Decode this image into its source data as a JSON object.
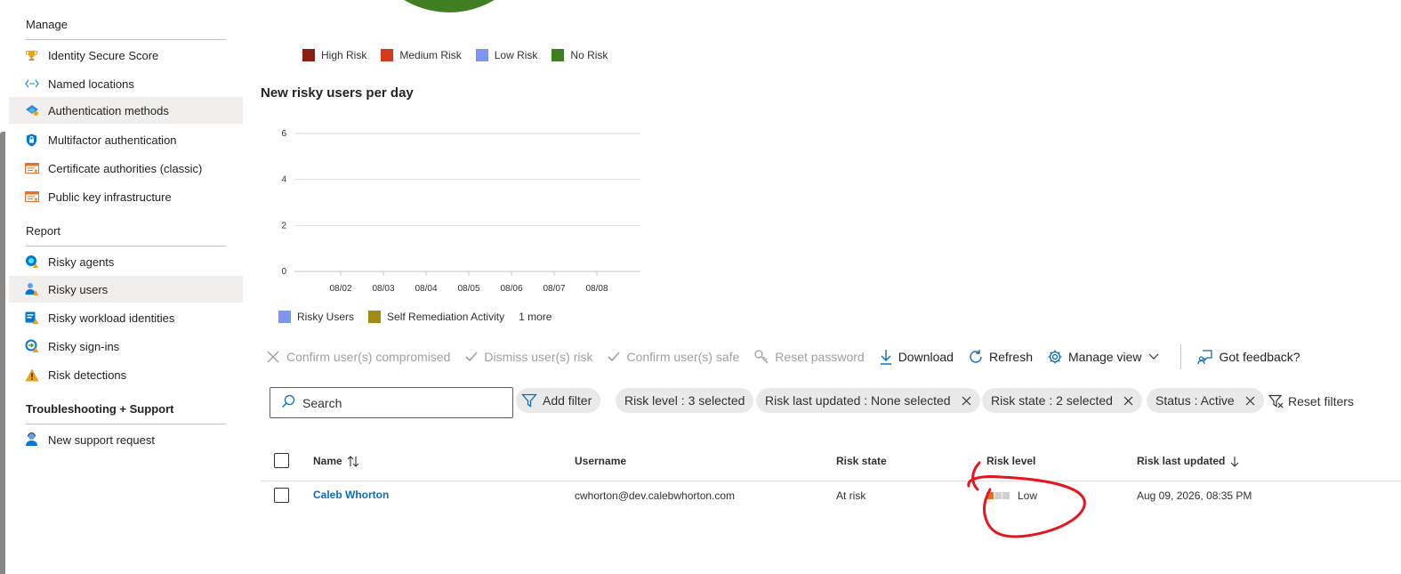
{
  "sidebar": {
    "sections": [
      {
        "title": "Manage"
      },
      {
        "title": "Report"
      },
      {
        "title": "Troubleshooting + Support"
      }
    ],
    "manage_items": [
      {
        "label": "Identity Secure Score",
        "icon": "trophy-icon"
      },
      {
        "label": "Named locations",
        "icon": "named-locations-icon"
      },
      {
        "label": "Authentication methods",
        "icon": "authentication-methods-icon"
      },
      {
        "label": "Multifactor authentication",
        "icon": "lock-shield-icon"
      },
      {
        "label": "Certificate authorities (classic)",
        "icon": "certificate-icon"
      },
      {
        "label": "Public key infrastructure",
        "icon": "certificate-icon"
      }
    ],
    "report_items": [
      {
        "label": "Risky agents",
        "icon": "risky-agents-icon"
      },
      {
        "label": "Risky users",
        "icon": "risky-users-icon"
      },
      {
        "label": "Risky workload identities",
        "icon": "workload-identities-icon"
      },
      {
        "label": "Risky sign-ins",
        "icon": "risky-signins-icon"
      },
      {
        "label": "Risk detections",
        "icon": "warning-icon"
      }
    ],
    "support_items": [
      {
        "label": "New support request",
        "icon": "support-person-icon"
      }
    ],
    "selected": [
      "Authentication methods",
      "Risky users"
    ]
  },
  "risk_legend": [
    {
      "label": "High Risk",
      "color": "#8b1f12"
    },
    {
      "label": "Medium Risk",
      "color": "#d13a1b"
    },
    {
      "label": "Low Risk",
      "color": "#7f95f0"
    },
    {
      "label": "No Risk",
      "color": "#3f7f22"
    }
  ],
  "chart_title": "New risky users per day",
  "chart_data": {
    "type": "bar",
    "title": "New risky users per day",
    "categories": [
      "08/02",
      "08/03",
      "08/04",
      "08/05",
      "08/06",
      "08/07",
      "08/08"
    ],
    "series": [
      {
        "name": "Risky Users",
        "values": [
          0,
          0,
          0,
          0,
          0,
          0,
          0
        ],
        "color": "#7f95f0"
      },
      {
        "name": "Self Remediation Activity",
        "values": [
          0,
          0,
          0,
          0,
          0,
          0,
          0
        ],
        "color": "#a38a14"
      }
    ],
    "yticks": [
      0,
      2,
      4,
      6
    ],
    "ylim": [
      0,
      6
    ],
    "grid": true,
    "legend_extra": "1 more"
  },
  "toolbar": {
    "confirm_compromised": "Confirm user(s) compromised",
    "dismiss_risk": "Dismiss user(s) risk",
    "confirm_safe": "Confirm user(s) safe",
    "reset_password": "Reset password",
    "download": "Download",
    "refresh": "Refresh",
    "manage_view": "Manage view",
    "feedback": "Got feedback?"
  },
  "filters": {
    "search_placeholder": "Search",
    "add_filter": "Add filter",
    "risk_level": "Risk level : 3 selected",
    "risk_last_updated": "Risk last updated : None selected",
    "risk_state": "Risk state : 2 selected",
    "status": "Status : Active",
    "reset": "Reset filters"
  },
  "table": {
    "headers": {
      "name": "Name",
      "username": "Username",
      "risk_state": "Risk state",
      "risk_level": "Risk level",
      "risk_last_updated": "Risk last updated"
    },
    "rows": [
      {
        "name": "Caleb Whorton",
        "username": "cwhorton@dev.calebwhorton.com",
        "risk_state": "At risk",
        "risk_level": "Low",
        "risk_last_updated": "Aug 09, 2026, 08:35 PM"
      }
    ]
  },
  "colors": {
    "accent": "#0f6cbd",
    "annotation": "#e8141e",
    "risk_low_block": "#d8742a"
  }
}
